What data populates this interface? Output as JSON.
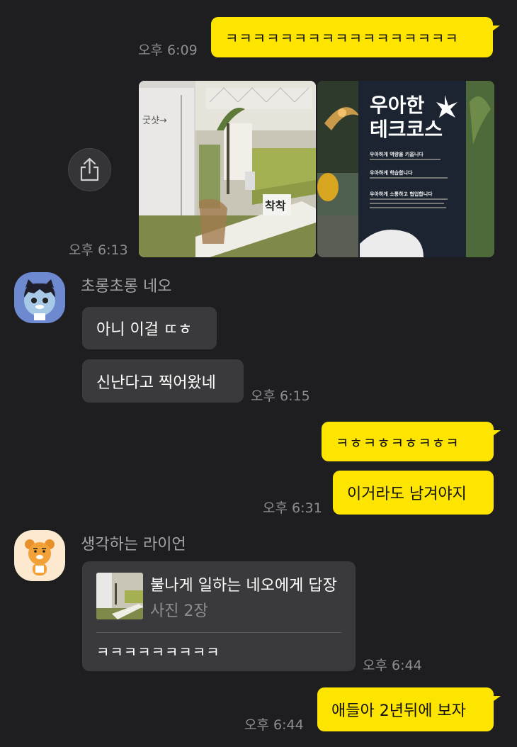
{
  "messages": {
    "m1": {
      "text": "ㅋㅋㅋㅋㅋㅋㅋㅋㅋㅋㅋㅋㅋㅋㅋㅋㅋ",
      "time": "오후 6:09"
    },
    "photos": {
      "time": "오후 6:13",
      "photo2_text": {
        "title_line1": "우아한",
        "title_line2": "테크코스",
        "b1": "우아하게 역량을 키웁니다",
        "b2": "우아하게 학습합니다",
        "b3": "우아하게 소통하고 협업합니다"
      },
      "photo1_text": {
        "sign": "굿샷→",
        "box": "착착"
      }
    },
    "neo": {
      "sender": "초롱초롱 네오",
      "msg1": "아니 이걸 ㄸㅎ",
      "msg2": "신난다고 찍어왔네",
      "time": "오후 6:15"
    },
    "m_me2": {
      "msg1": "ㅋㅎㅋㅎㅋㅎㅋㅎㅋ",
      "msg2": "이거라도 남겨야지",
      "time": "오후 6:31"
    },
    "ryan": {
      "sender": "생각하는 라이언",
      "reply_title": "불나게 일하는 네오에게 답장",
      "reply_sub": "사진 2장",
      "msg": "ㅋㅋㅋㅋㅋㅋㅋㅋㅋ",
      "time": "오후 6:44"
    },
    "m_last": {
      "text": "애들아 2년뒤에 보자",
      "time": "오후 6:44"
    }
  },
  "icons": {
    "share": "share-icon"
  },
  "colors": {
    "background": "#1e1e20",
    "my_bubble": "#fee500",
    "their_bubble": "#3a3a3c",
    "time": "#8e8e92"
  }
}
